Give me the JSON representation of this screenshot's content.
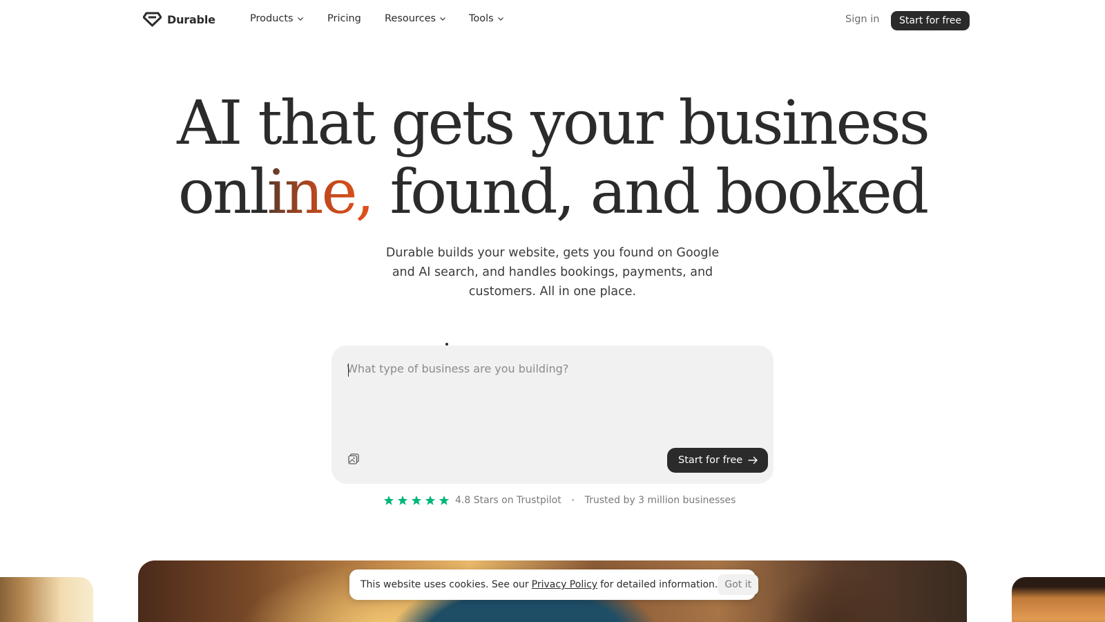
{
  "nav": {
    "brand": "Durable",
    "logo_icon": "diamond-logo-icon",
    "menu": [
      {
        "label": "Products",
        "has_dropdown": true
      },
      {
        "label": "Pricing",
        "has_dropdown": false
      },
      {
        "label": "Resources",
        "has_dropdown": true
      },
      {
        "label": "Tools",
        "has_dropdown": true
      }
    ],
    "sign_in": "Sign in",
    "cta": "Start for free"
  },
  "hero": {
    "headline_line1": "AI that gets your business",
    "headline_line2_prefix": "onl",
    "headline_line2_accent": "ine,",
    "headline_line2_suffix": " found, and booked",
    "subtext": "Durable builds your website, gets you found on Google and AI search, and handles bookings, payments, and customers. All in one place.",
    "accent_colors": [
      "#5a3a2a",
      "#b8471e",
      "#e4521b"
    ]
  },
  "prompt": {
    "placeholder": "What type of business are you building?",
    "value": "",
    "attach_icon": "image-attach-icon",
    "cta": "Start for free",
    "cta_icon": "arrow-right-icon"
  },
  "trust": {
    "stars": 5,
    "star_color": "#00b67a",
    "rating_text": "4.8 Stars on Trustpilot",
    "separator": "•",
    "trusted_text": "Trusted by 3 million businesses"
  },
  "cookie": {
    "text_before": "This website uses cookies. See our",
    "link": "Privacy Policy",
    "text_after": "for detailed information.",
    "button": "Got it"
  }
}
